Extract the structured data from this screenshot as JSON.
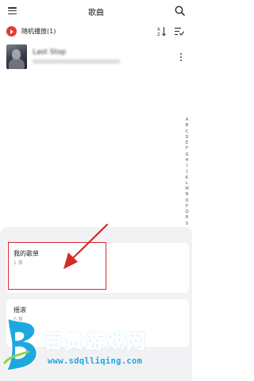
{
  "header": {
    "title": "歌曲"
  },
  "shuffle": {
    "label": "随机播放(1)"
  },
  "song": {
    "title": "Last Stop"
  },
  "alpha_index": [
    "A",
    "B",
    "C",
    "D",
    "E",
    "F",
    "G",
    "H",
    "I",
    "J",
    "K",
    "L",
    "M",
    "N",
    "O",
    "P",
    "Q",
    "R",
    "S"
  ],
  "playlists": [
    {
      "name": "我的歌单",
      "count": "1 首"
    },
    {
      "name": "摇滚",
      "count": "0 首"
    }
  ],
  "watermark": {
    "chars": "百贵游戏网",
    "url": "www.sdqlliqing.com"
  },
  "colors": {
    "accent": "#e53935",
    "annotation": "#d32a2a",
    "watermark": "#1fa7e0"
  }
}
